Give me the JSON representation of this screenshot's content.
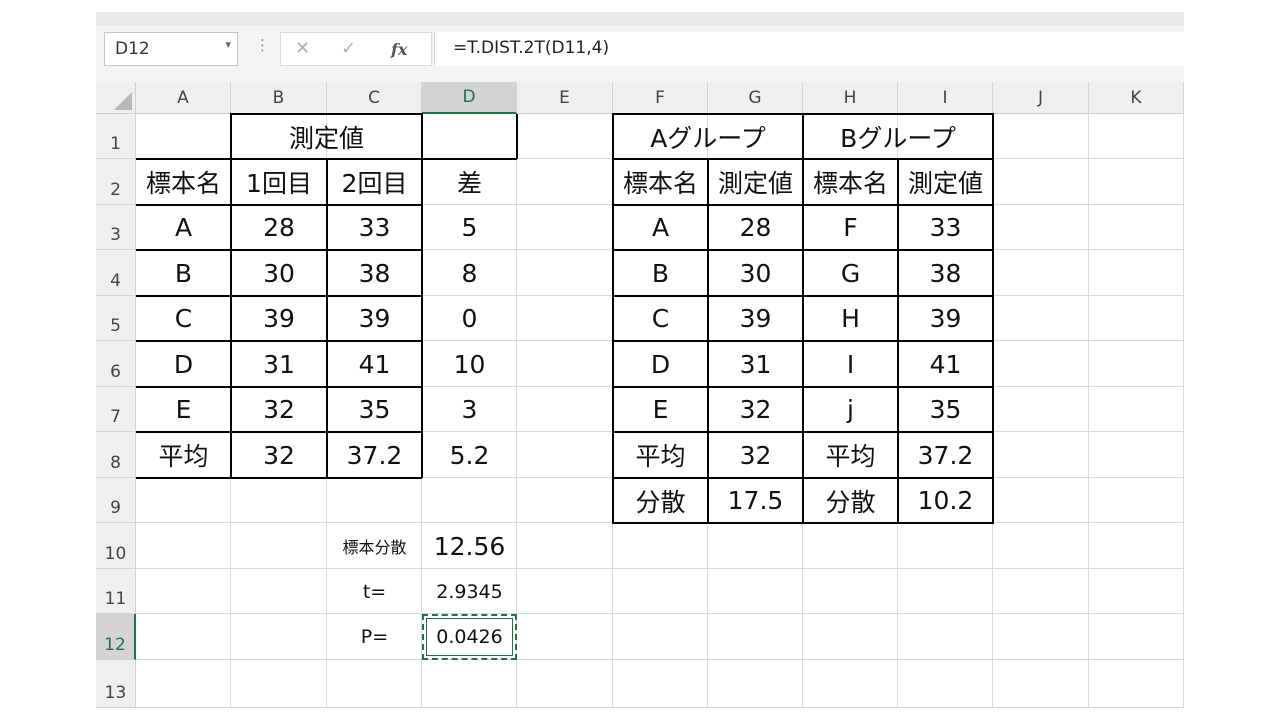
{
  "name_box": "D12",
  "formula": "=T.DIST.2T(D11,4)",
  "toolbar": {
    "more": "⋮",
    "cancel": "✕",
    "enter": "✓",
    "fx": "fx",
    "dropdown": "▾"
  },
  "columns": [
    "A",
    "B",
    "C",
    "D",
    "E",
    "F",
    "G",
    "H",
    "I",
    "J",
    "K"
  ],
  "rows": [
    "1",
    "2",
    "3",
    "4",
    "5",
    "6",
    "7",
    "8",
    "9",
    "10",
    "11",
    "12",
    "13"
  ],
  "cells": {
    "B1": "測定値",
    "A2": "標本名",
    "B2": "1回目",
    "C2": "2回目",
    "D2": "差",
    "A3": "A",
    "B3": "28",
    "C3": "33",
    "D3": "5",
    "A4": "B",
    "B4": "30",
    "C4": "38",
    "D4": "8",
    "A5": "C",
    "B5": "39",
    "C5": "39",
    "D5": "0",
    "A6": "D",
    "B6": "31",
    "C6": "41",
    "D6": "10",
    "A7": "E",
    "B7": "32",
    "C7": "35",
    "D7": "3",
    "A8": "平均",
    "B8": "32",
    "C8": "37.2",
    "D8": "5.2",
    "C10": "標本分散",
    "D10": "12.56",
    "C11": "t=",
    "D11": "2.9345",
    "C12": "P=",
    "D12": "0.0426",
    "F1": "Aグループ",
    "H1": "Bグループ",
    "F2": "標本名",
    "G2": "測定値",
    "H2": "標本名",
    "I2": "測定値",
    "F3": "A",
    "G3": "28",
    "H3": "F",
    "I3": "33",
    "F4": "B",
    "G4": "30",
    "H4": "G",
    "I4": "38",
    "F5": "C",
    "G5": "39",
    "H5": "H",
    "I5": "39",
    "F6": "D",
    "G6": "31",
    "H6": "I",
    "I6": "41",
    "F7": "E",
    "G7": "32",
    "H7": "j",
    "I7": "35",
    "F8": "平均",
    "G8": "32",
    "H8": "平均",
    "I8": "37.2",
    "F9": "分散",
    "G9": "17.5",
    "H9": "分散",
    "I9": "10.2"
  },
  "accent_color": "#217346"
}
